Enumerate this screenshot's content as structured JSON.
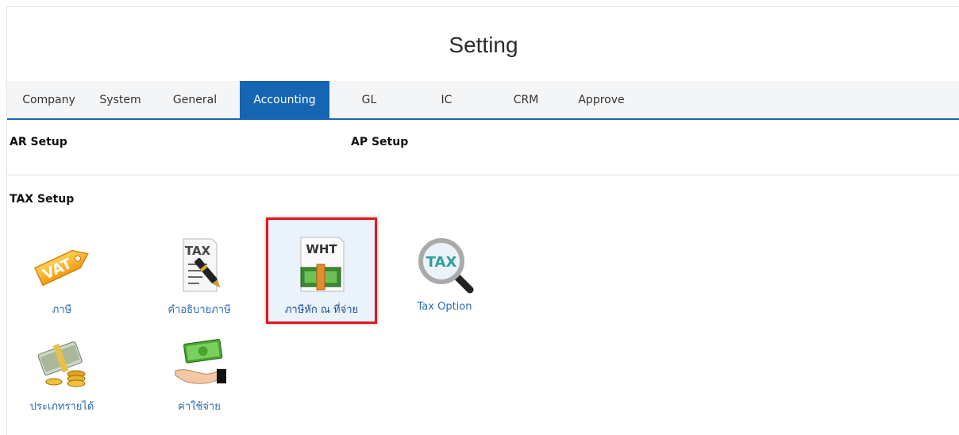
{
  "page": {
    "title": "Setting"
  },
  "tabs": [
    {
      "label": "Company",
      "active": false
    },
    {
      "label": "System",
      "active": false
    },
    {
      "label": "General",
      "active": false
    },
    {
      "label": "Accounting",
      "active": true
    },
    {
      "label": "GL",
      "active": false
    },
    {
      "label": "IC",
      "active": false
    },
    {
      "label": "CRM",
      "active": false
    },
    {
      "label": "Approve",
      "active": false
    }
  ],
  "sections": {
    "ar_setup": "AR Setup",
    "ap_setup": "AP Setup",
    "tax_setup": "TAX Setup"
  },
  "tax_items": [
    {
      "label": "ภาษี",
      "icon": "vat-tag-icon",
      "icon_text": "VAT"
    },
    {
      "label": "คำอธิบายภาษี",
      "icon": "tax-document-pen-icon",
      "icon_text": "TAX"
    },
    {
      "label": "ภาษีหัก ณ ที่จ่าย",
      "icon": "wht-money-icon",
      "icon_text": "WHT",
      "selected": true
    },
    {
      "label": "Tax Option",
      "icon": "tax-magnifier-icon",
      "icon_text": "TAX"
    },
    {
      "label": "ประเภทรายได้",
      "icon": "money-coins-icon"
    },
    {
      "label": "ค่าใช้จ่าย",
      "icon": "hand-money-icon"
    }
  ],
  "colors": {
    "accent": "#1565b3",
    "highlight_border": "#e0191f",
    "link": "#2a6bb5"
  }
}
